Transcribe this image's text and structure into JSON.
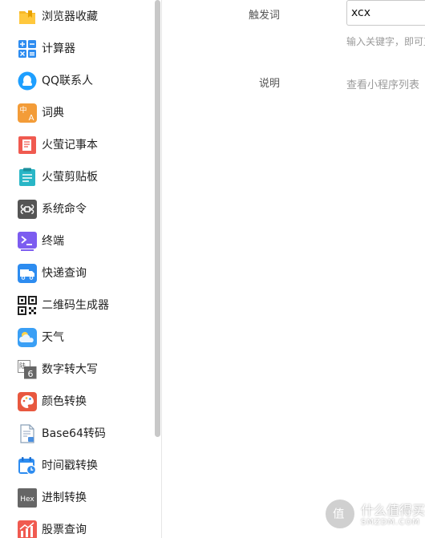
{
  "sidebar": {
    "items": [
      {
        "label": "浏览器收藏",
        "icon": "bookmark-folder-icon"
      },
      {
        "label": "计算器",
        "icon": "calculator-icon"
      },
      {
        "label": "QQ联系人",
        "icon": "qq-icon"
      },
      {
        "label": "词典",
        "icon": "dictionary-icon"
      },
      {
        "label": "火萤记事本",
        "icon": "notebook-icon"
      },
      {
        "label": "火萤剪贴板",
        "icon": "clipboard-icon"
      },
      {
        "label": "系统命令",
        "icon": "command-icon"
      },
      {
        "label": "终端",
        "icon": "terminal-icon"
      },
      {
        "label": "快递查询",
        "icon": "delivery-truck-icon"
      },
      {
        "label": "二维码生成器",
        "icon": "qrcode-icon"
      },
      {
        "label": "天气",
        "icon": "weather-cloud-icon"
      },
      {
        "label": "数字转大写",
        "icon": "number-convert-icon"
      },
      {
        "label": "颜色转换",
        "icon": "palette-icon"
      },
      {
        "label": "Base64转码",
        "icon": "base64-file-icon"
      },
      {
        "label": "时间戳转换",
        "icon": "calendar-clock-icon"
      },
      {
        "label": "进制转换",
        "icon": "hex-icon"
      },
      {
        "label": "股票查询",
        "icon": "stock-chart-icon"
      }
    ],
    "icon_glyphs": {
      "dictionary": [
        "中",
        "A"
      ],
      "number_convert": [
        "陆",
        "6"
      ],
      "hex": "Hex"
    }
  },
  "main": {
    "trigger_label": "触发词",
    "trigger_value": "xcx",
    "trigger_hint": "输入关键字，即可直接使用",
    "description_label": "说明",
    "description_value": "查看小程序列表"
  },
  "watermark": {
    "title": "什么值得买",
    "subtitle": "SMZDM.COM",
    "logo_glyph": "值"
  }
}
